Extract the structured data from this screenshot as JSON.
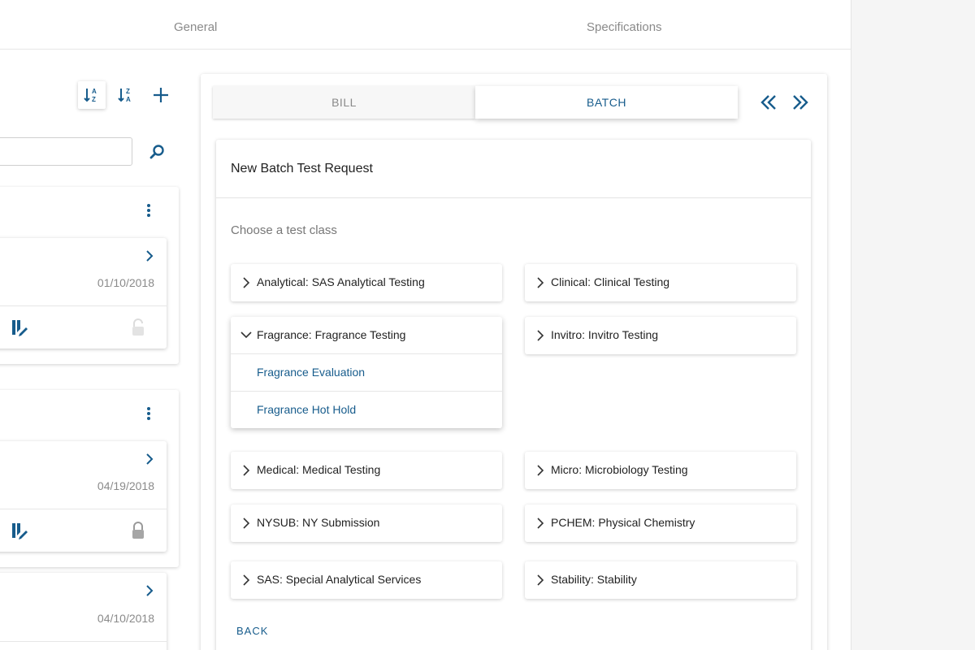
{
  "top_tabs": {
    "general": "General",
    "specifications": "Specifications"
  },
  "left": {
    "toolbar": {
      "sort_az": "sort-az-icon",
      "sort_za": "sort-za-icon",
      "add": "plus-icon"
    },
    "search": {
      "value": "",
      "placeholder": ""
    },
    "cards": [
      {
        "date": "01/10/2018",
        "locked": false
      },
      {
        "date": "04/19/2018",
        "locked": true
      },
      {
        "date": "04/10/2018",
        "locked": false
      }
    ]
  },
  "panel": {
    "tabs": {
      "bill": "BILL",
      "batch": "BATCH",
      "active": "batch"
    },
    "title": "New Batch Test Request",
    "subtitle": "Choose a test class",
    "test_classes": [
      "Analytical: SAS Analytical Testing",
      "Clinical: Clinical Testing",
      "Fragrance: Fragrance Testing",
      "Invitro: Invitro Testing",
      "Medical: Medical Testing",
      "Micro: Microbiology Testing",
      "NYSUB: NY Submission",
      "PCHEM: Physical Chemistry",
      "SAS: Special Analytical Services",
      "Stability: Stability"
    ],
    "expanded_subitems": [
      "Fragrance Evaluation",
      "Fragrance Hot Hold"
    ],
    "back": "BACK"
  },
  "colors": {
    "accent": "#175c8c",
    "muted": "#8a8a8a",
    "divider": "#e6e6e6"
  }
}
